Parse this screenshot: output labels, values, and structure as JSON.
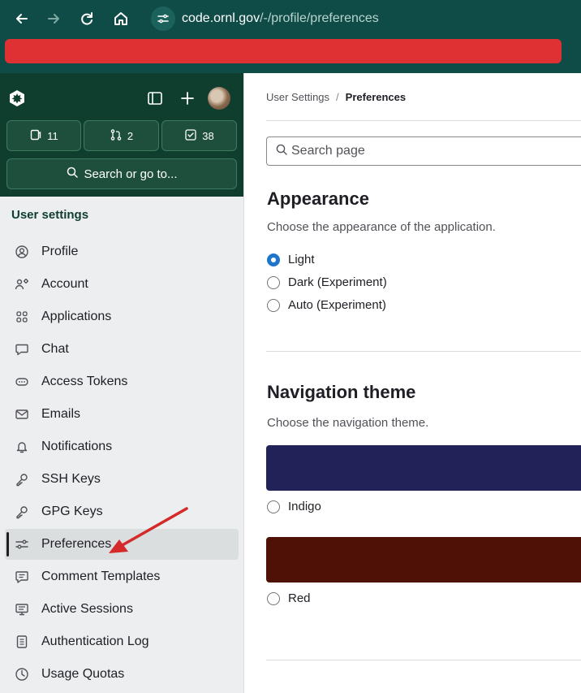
{
  "browser": {
    "url_host": "code.ornl.gov",
    "url_path": "/-/profile/preferences"
  },
  "sidebar": {
    "counters": [
      {
        "icon": "issues-icon",
        "count": "11"
      },
      {
        "icon": "merge-request-icon",
        "count": "2"
      },
      {
        "icon": "todo-icon",
        "count": "38"
      }
    ],
    "search_label": "Search or go to...",
    "heading": "User settings",
    "items": [
      {
        "label": "Profile",
        "icon": "profile-icon"
      },
      {
        "label": "Account",
        "icon": "account-icon"
      },
      {
        "label": "Applications",
        "icon": "applications-icon"
      },
      {
        "label": "Chat",
        "icon": "chat-icon"
      },
      {
        "label": "Access Tokens",
        "icon": "token-icon"
      },
      {
        "label": "Emails",
        "icon": "mail-icon"
      },
      {
        "label": "Notifications",
        "icon": "bell-icon"
      },
      {
        "label": "SSH Keys",
        "icon": "key-icon"
      },
      {
        "label": "GPG Keys",
        "icon": "key-icon"
      },
      {
        "label": "Preferences",
        "icon": "preferences-icon",
        "active": true
      },
      {
        "label": "Comment Templates",
        "icon": "comment-icon"
      },
      {
        "label": "Active Sessions",
        "icon": "monitor-icon"
      },
      {
        "label": "Authentication Log",
        "icon": "log-icon"
      },
      {
        "label": "Usage Quotas",
        "icon": "quota-icon"
      }
    ]
  },
  "main": {
    "breadcrumb": {
      "parent": "User Settings",
      "separator": "/",
      "current": "Preferences"
    },
    "search_placeholder": "Search page",
    "appearance": {
      "title": "Appearance",
      "description": "Choose the appearance of the application.",
      "options": [
        {
          "label": "Light",
          "checked": true
        },
        {
          "label": "Dark (Experiment)",
          "checked": false
        },
        {
          "label": "Auto (Experiment)",
          "checked": false
        }
      ]
    },
    "navigation_theme": {
      "title": "Navigation theme",
      "description": "Choose the navigation theme.",
      "themes": [
        {
          "label": "Indigo",
          "color": "#222158",
          "checked": false
        },
        {
          "label": "Red",
          "color": "#4f1105",
          "checked": false
        }
      ]
    }
  },
  "colors": {
    "browser_bar": "#0f4c47",
    "sidebar_header": "#0f3d2e",
    "redaction": "#df3133",
    "radio_checked": "#1f75cb",
    "annotation_arrow": "#d42a2a"
  }
}
